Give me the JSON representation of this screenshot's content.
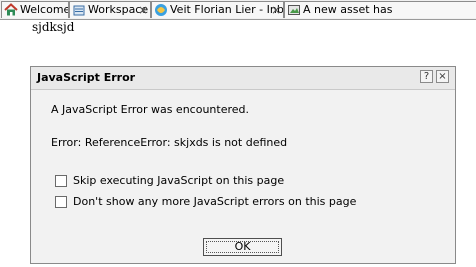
{
  "tabs": [
    {
      "label": "Welcome",
      "icon": "home-icon",
      "close": "×"
    },
    {
      "label": "Workspace",
      "icon": "workspace-icon",
      "close": "×"
    },
    {
      "label": "Veit Florian Lier - Inbox",
      "icon": "inbox-icon",
      "close": "×"
    },
    {
      "label": "A new asset has",
      "icon": "asset-icon"
    }
  ],
  "page": {
    "text": "sjdksjd"
  },
  "dialog": {
    "title": "JavaScript Error",
    "help_label": "?",
    "close_label": "×",
    "message": "A JavaScript Error was encountered.",
    "error": "Error: ReferenceError: skjxds is not defined",
    "checkbox_skip": "Skip executing JavaScript on this page",
    "checkbox_dont_show": "Don't show any more JavaScript errors on this page",
    "ok_label": "OK"
  }
}
